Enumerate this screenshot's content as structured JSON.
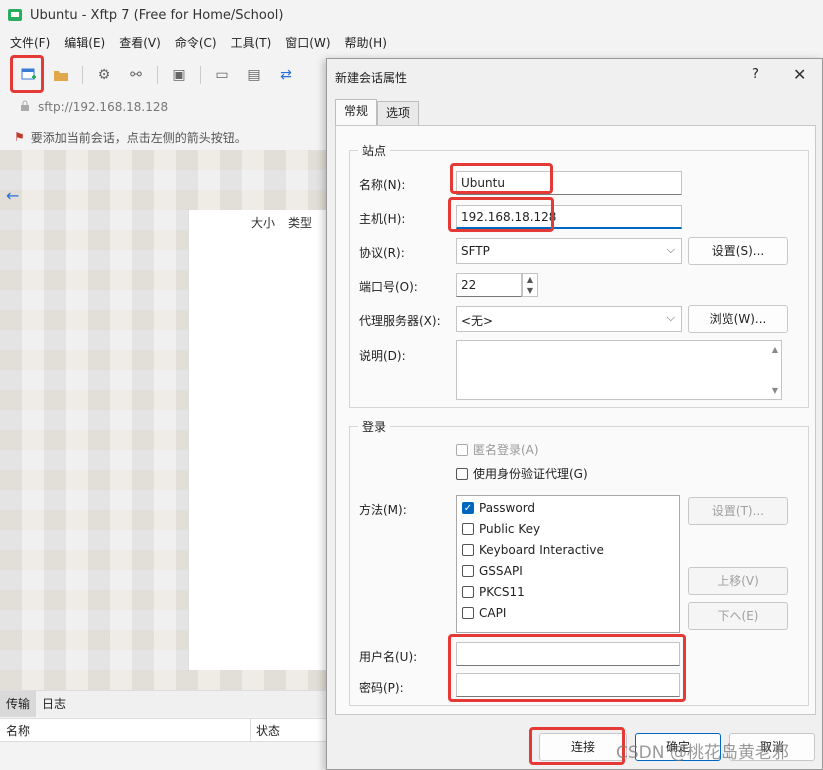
{
  "window": {
    "title": "Ubuntu - Xftp 7 (Free for Home/School)"
  },
  "menu": [
    "文件(F)",
    "编辑(E)",
    "查看(V)",
    "命令(C)",
    "工具(T)",
    "窗口(W)",
    "帮助(H)"
  ],
  "address": {
    "value": "sftp://192.168.18.128"
  },
  "hint": "要添加当前会话，点击左侧的箭头按钮。",
  "file_columns": {
    "size": "大小",
    "type": "类型"
  },
  "bottom": {
    "tabs": [
      "传输",
      "日志"
    ],
    "col_name": "名称",
    "col_status": "状态"
  },
  "dialog": {
    "title": "新建会话属性",
    "help": "?",
    "close": "✕",
    "tabs": [
      "常规",
      "选项"
    ],
    "site": {
      "group_title": "站点",
      "name_label": "名称(N):",
      "name_value": "Ubuntu",
      "host_label": "主机(H):",
      "host_value": "192.168.18.128",
      "protocol_label": "协议(R):",
      "protocol_value": "SFTP",
      "protocol_settings": "设置(S)...",
      "port_label": "端口号(O):",
      "port_value": "22",
      "proxy_label": "代理服务器(X):",
      "proxy_value": "<无>",
      "proxy_browse": "浏览(W)...",
      "desc_label": "说明(D):"
    },
    "login": {
      "group_title": "登录",
      "anonymous": "匿名登录(A)",
      "agent": "使用身份验证代理(G)",
      "method_label": "方法(M):",
      "methods": [
        {
          "label": "Password",
          "checked": true
        },
        {
          "label": "Public Key",
          "checked": false
        },
        {
          "label": "Keyboard Interactive",
          "checked": false
        },
        {
          "label": "GSSAPI",
          "checked": false
        },
        {
          "label": "PKCS11",
          "checked": false
        },
        {
          "label": "CAPI",
          "checked": false
        }
      ],
      "method_settings": "设置(T)...",
      "move_up": "上移(V)",
      "move_down": "下へ(E)",
      "username_label": "用户名(U):",
      "username_value": "",
      "password_label": "密码(P):",
      "password_value": ""
    },
    "buttons": {
      "connect": "连接",
      "ok": "确定",
      "cancel": "取消"
    }
  },
  "watermark": "CSDN @桃花岛黄老邪",
  "colors": {
    "highlight": "#e53935",
    "accent": "#0067c0"
  }
}
